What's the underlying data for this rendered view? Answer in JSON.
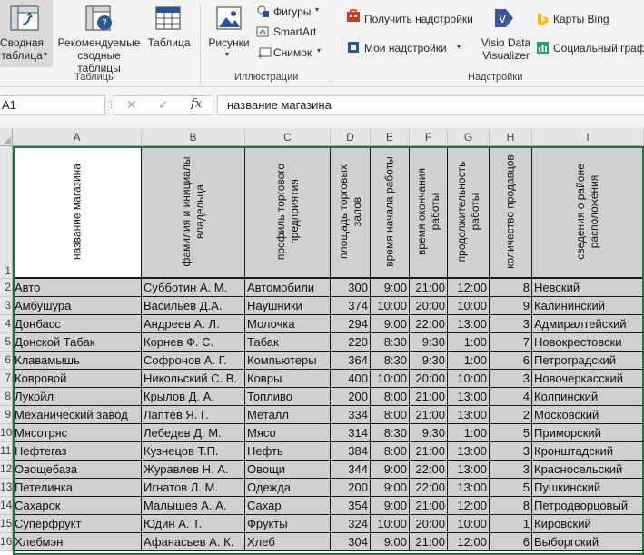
{
  "ribbon": {
    "pivot_table": "Сводная\nтаблица",
    "recommended_pivot": "Рекомендуемые\nсводные таблицы",
    "table": "Таблица",
    "group_tables": "Таблицы",
    "pictures": "Рисунки",
    "shapes": "Фигуры",
    "smartart": "SmartArt",
    "screenshot": "Снимок",
    "group_illustrations": "Иллюстрации",
    "get_addins": "Получить надстройки",
    "my_addins": "Мои надстройки",
    "visio": "Visio Data\nVisualizer",
    "bing_maps": "Карты Bing",
    "people_graph": "Социальный граф",
    "group_addins": "Надстройки"
  },
  "formula_bar": {
    "cell_ref": "A1",
    "value": "название магазина",
    "fx": "fx"
  },
  "columns": [
    "A",
    "B",
    "C",
    "D",
    "E",
    "F",
    "G",
    "H",
    "I"
  ],
  "header_row": {
    "row_number": "1",
    "labels": [
      "название магазина",
      "фамилия и инициалы владельца",
      "профиль торгового предприятия",
      "площадь торговых залов",
      "время начала работы",
      "время окончания работы",
      "продолжительность работы",
      "количество продавцов",
      "сведения о районе расположения"
    ]
  },
  "rows": [
    {
      "n": "2",
      "c": [
        "Авто",
        "Субботин А. М.",
        "Автомобили",
        "300",
        "9:00",
        "21:00",
        "12:00",
        "8",
        "Невский"
      ]
    },
    {
      "n": "3",
      "c": [
        "Амбушура",
        "Васильев Д.А.",
        "Наушники",
        "374",
        "10:00",
        "20:00",
        "10:00",
        "9",
        "Калининский"
      ]
    },
    {
      "n": "4",
      "c": [
        "Донбасс",
        "Андреев А. Л.",
        "Молочка",
        "294",
        "9:00",
        "22:00",
        "13:00",
        "3",
        "Адмиралтейский"
      ]
    },
    {
      "n": "5",
      "c": [
        "Донской Табак",
        "Корнев Ф. С.",
        "Табак",
        "220",
        "8:30",
        "9:30",
        "1:00",
        "7",
        "Новокрестовски"
      ]
    },
    {
      "n": "6",
      "c": [
        "Клавамышь",
        "Софронов А. Г.",
        "Компьютеры",
        "364",
        "8:30",
        "9:30",
        "1:00",
        "6",
        "Петроградский"
      ]
    },
    {
      "n": "7",
      "c": [
        "Ковровой",
        "Никольский С. В.",
        "Ковры",
        "400",
        "10:00",
        "20:00",
        "10:00",
        "3",
        "Новочеркасский"
      ]
    },
    {
      "n": "8",
      "c": [
        "Лукойл",
        "Крылов Д. А.",
        "Топливо",
        "200",
        "8:00",
        "21:00",
        "13:00",
        "4",
        "Колпинский"
      ]
    },
    {
      "n": "9",
      "c": [
        "Механический завод",
        "Лаптев Я. Г.",
        "Металл",
        "334",
        "8:00",
        "21:00",
        "13:00",
        "2",
        "Московский"
      ]
    },
    {
      "n": "10",
      "c": [
        "Мясотряс",
        "Лебедев Д. М.",
        "Мясо",
        "314",
        "8:30",
        "9:30",
        "1:00",
        "5",
        "Приморский"
      ]
    },
    {
      "n": "11",
      "c": [
        "Нефтегаз",
        "Кузнецов Т.П.",
        "Нефть",
        "384",
        "8:00",
        "21:00",
        "13:00",
        "3",
        "Кронштадский"
      ]
    },
    {
      "n": "12",
      "c": [
        "Овощебаза",
        "Журавлев Н. А.",
        "Овощи",
        "344",
        "9:00",
        "22:00",
        "13:00",
        "3",
        "Красносельский"
      ]
    },
    {
      "n": "13",
      "c": [
        "Петелинка",
        "Игнатов Л. М.",
        "Одежда",
        "200",
        "9:00",
        "22:00",
        "13:00",
        "5",
        "Пушкинский"
      ]
    },
    {
      "n": "14",
      "c": [
        "Сахарок",
        "Малышев А. А.",
        "Сахар",
        "354",
        "9:00",
        "21:00",
        "12:00",
        "8",
        "Петродворцовый"
      ]
    },
    {
      "n": "15",
      "c": [
        "Суперфрукт",
        "Юдин А. Т.",
        "Фрукты",
        "324",
        "10:00",
        "20:00",
        "10:00",
        "1",
        "Кировский"
      ]
    },
    {
      "n": "16",
      "c": [
        "Хлебмэн",
        "Афанасьев А. К.",
        "Хлеб",
        "304",
        "9:00",
        "21:00",
        "12:00",
        "6",
        "Выборгский"
      ]
    }
  ],
  "colors": {
    "accent": "#217346",
    "cell_fill": "#d0d0d0",
    "header_fill": "#e6e6e6"
  }
}
